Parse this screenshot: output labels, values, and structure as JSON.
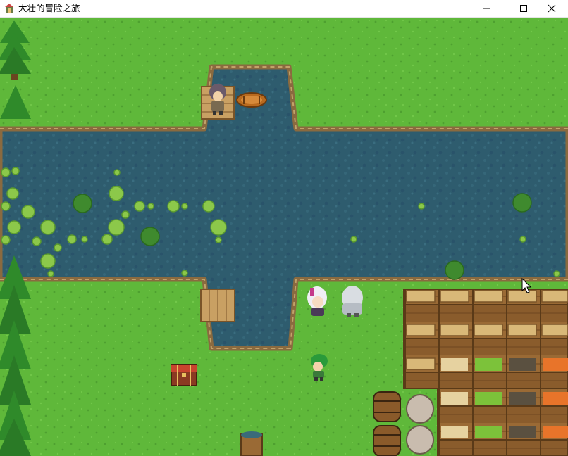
{
  "window": {
    "title": "大壮的冒险之旅",
    "controls": [
      "minimize-icon",
      "maximize-icon",
      "close-icon"
    ]
  },
  "colors": {
    "grass": "#5fb83a",
    "water": "#2e5c6e",
    "shore": "#8a6a3f",
    "wood": "#b98a4a",
    "title_bar": "#ffffff"
  },
  "scene": {
    "type": "top-down RPG town map",
    "objects": [
      "river",
      "lily-pads",
      "wooden-dock",
      "rowboat",
      "fisherman-npc",
      "bridge",
      "treasure-chest",
      "hero",
      "white-haired-girl",
      "grey-haired-elder",
      "market-crates",
      "fruit-crates",
      "barrels",
      "clay-pots",
      "water-bucket",
      "pine-trees"
    ],
    "cursor": "pointer-icon"
  }
}
